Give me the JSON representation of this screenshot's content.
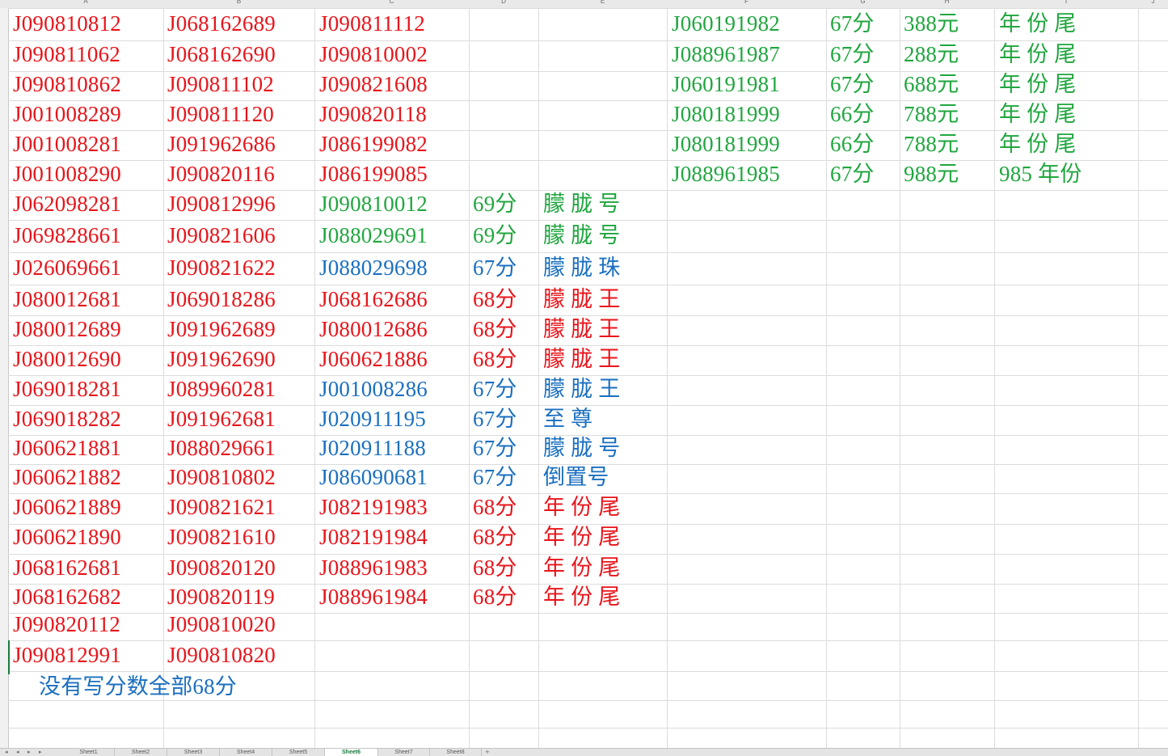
{
  "colors": {
    "red": "#e8141a",
    "green": "#20a63f",
    "blue": "#1a6fc0"
  },
  "columns": [
    "A",
    "B",
    "C",
    "D",
    "E",
    "F",
    "G",
    "H",
    "I",
    "J"
  ],
  "cells": {
    "A": [
      "J090810812",
      "J090811062",
      "J090810862",
      "J001008289",
      "J001008281",
      "J001008290",
      "J062098281",
      "J069828661",
      "J026069661",
      "J080012681",
      "J080012689",
      "J080012690",
      "J069018281",
      "J069018282",
      "J060621881",
      "J060621882",
      "J060621889",
      "J060621890",
      "J068162681",
      "J068162682",
      "J090820112",
      "J090812991"
    ],
    "B": [
      "J068162689",
      "J068162690",
      "J090811102",
      "J090811120",
      "J091962686",
      "J090820116",
      "J090812996",
      "J090821606",
      "J090821622",
      "J069018286",
      "J091962689",
      "J091962690",
      "J089960281",
      "J091962681",
      "J088029661",
      "J090810802",
      "J090821621",
      "J090821610",
      "J090820120",
      "J090820119",
      "J090810020",
      "J090810820"
    ],
    "C": [
      "J090811112",
      "J090810002",
      "J090821608",
      "J090820118",
      "J086199082",
      "J086199085",
      "J090810012",
      "J088029691",
      "J088029698",
      "J068162686",
      "J080012686",
      "J060621886",
      "J001008286",
      "J020911195",
      "J020911188",
      "J086090681",
      "J082191983",
      "J082191984",
      "J088961983",
      "J088961984"
    ],
    "D": [
      "69分",
      "69分",
      "67分",
      "68分",
      "68分",
      "68分",
      "67分",
      "67分",
      "67分",
      "67分",
      "68分",
      "68分",
      "68分",
      "68分"
    ],
    "E": [
      "朦 胧 号",
      "朦 胧 号",
      "朦 胧 珠",
      "朦 胧 王",
      "朦 胧 王",
      "朦 胧 王",
      "朦 胧 王",
      "至 尊",
      "朦 胧 号",
      "倒置号",
      "年 份 尾",
      "年 份 尾",
      "年 份 尾",
      "年 份 尾"
    ],
    "F": [
      "J060191982",
      "J088961987",
      "J060191981",
      "J080181999",
      "J080181999",
      "J088961985"
    ],
    "G": [
      "67分",
      "67分",
      "67分",
      "66分",
      "66分",
      "67分"
    ],
    "H": [
      "388元",
      "288元",
      "688元",
      "788元",
      "788元",
      "988元"
    ],
    "I": [
      "年 份 尾",
      "年 份 尾",
      "年 份 尾",
      "年 份 尾",
      "年 份 尾",
      "985 年份"
    ]
  },
  "note": "没有写分数全部68分",
  "sheet_tabs": [
    "Sheet1",
    "Sheet2",
    "Sheet3",
    "Sheet4",
    "Sheet5",
    "Sheet6",
    "Sheet7",
    "Sheet8"
  ],
  "active_tab": "Sheet6",
  "tab_nav": [
    "◂",
    "◂",
    "▸",
    "▸",
    "+"
  ]
}
